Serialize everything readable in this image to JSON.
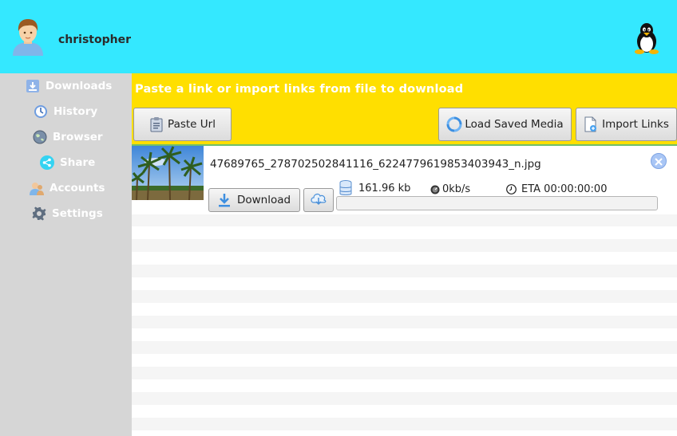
{
  "header": {
    "username": "christopher",
    "avatar_icon": "user-avatar-icon",
    "os_icon": "linux-tux-icon"
  },
  "sidebar": {
    "items": [
      {
        "label": "Downloads",
        "icon": "downloads-icon"
      },
      {
        "label": "History",
        "icon": "history-icon"
      },
      {
        "label": "Browser",
        "icon": "browser-icon"
      },
      {
        "label": "Share",
        "icon": "share-icon"
      },
      {
        "label": "Accounts",
        "icon": "accounts-icon"
      },
      {
        "label": "Settings",
        "icon": "settings-icon"
      }
    ]
  },
  "banner": {
    "title": "Paste a link or import links from file to download",
    "paste_label": "Paste Url",
    "load_label": "Load Saved Media",
    "import_label": "Import Links"
  },
  "download_item": {
    "filename": "47689765_278702502841116_6224779619853403943_n.jpg",
    "download_label": "Download",
    "size": "161.96 kb",
    "speed": "0kb/s",
    "eta": "ETA 00:00:00:00",
    "progress": 0
  },
  "colors": {
    "header_bg": "#34e8ff",
    "banner_bg": "#ffdf00",
    "sidebar_bg": "#d6d6d6"
  }
}
